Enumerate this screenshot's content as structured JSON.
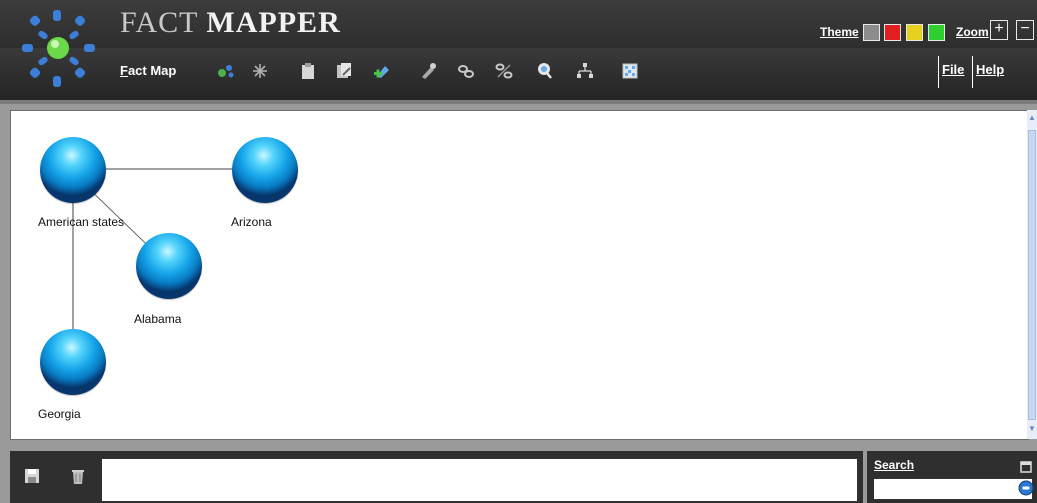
{
  "app": {
    "title_part1": "FACT ",
    "title_part2": "MAPPER"
  },
  "header": {
    "theme_label": "Theme",
    "theme_colors": [
      "#8c8c8c",
      "#e02020",
      "#e6d21e",
      "#2ecf2e"
    ],
    "zoom_label": "Zoom",
    "zoom_in": "+",
    "zoom_out": "−"
  },
  "toolbar": {
    "title": "Fact Map",
    "tools": [
      "expand-nodes-icon",
      "clear-selection-icon",
      "clipboard-icon",
      "document-edit-icon",
      "add-fact-icon",
      "pin-icon",
      "link-icon",
      "unlink-icon",
      "search-fact-icon",
      "hierarchy-icon",
      "table-icon"
    ]
  },
  "menu": {
    "file": "File",
    "help": "Help"
  },
  "map": {
    "nodes": [
      {
        "id": "american-states",
        "label": "American states"
      },
      {
        "id": "arizona",
        "label": "Arizona"
      },
      {
        "id": "alabama",
        "label": "Alabama"
      },
      {
        "id": "georgia",
        "label": "Georgia"
      }
    ]
  },
  "bottom": {
    "save_icon": "save-icon",
    "delete_icon": "trash-icon",
    "notes_value": ""
  },
  "search": {
    "label": "Search",
    "value": ""
  }
}
